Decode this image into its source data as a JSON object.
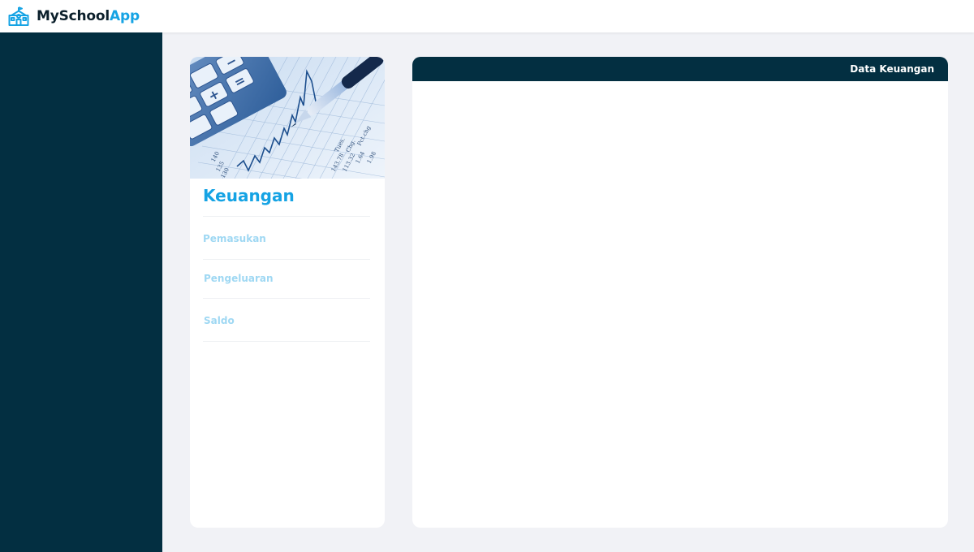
{
  "app": {
    "name_part1": "MySchool",
    "name_part2": "App",
    "logo_icon": "school-building-icon",
    "brand_color": "#15a3e4"
  },
  "sidebar": {
    "background": "#032f41"
  },
  "menu_card": {
    "image": "finance-calculator-chart-photo",
    "title": "Keuangan",
    "items": [
      {
        "label": "Pemasukan"
      },
      {
        "label": "Pengeluaran"
      },
      {
        "label": "Saldo"
      }
    ]
  },
  "data_panel": {
    "title": "Data Keuangan"
  }
}
